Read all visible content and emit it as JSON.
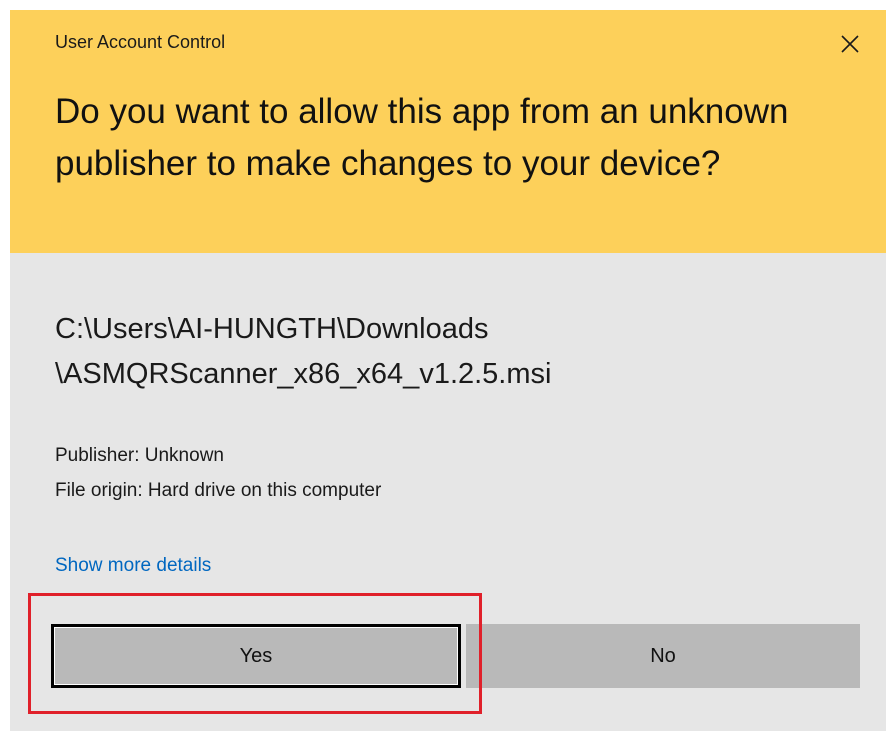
{
  "dialog": {
    "window_title": "User Account Control",
    "question": "Do you want to allow this app from an unknown publisher to make changes to your device?",
    "file_path_line1": "C:\\Users\\AI-HUNGTH\\Downloads",
    "file_path_line2": "\\ASMQRScanner_x86_x64_v1.2.5.msi",
    "publisher": "Publisher: Unknown",
    "file_origin": "File origin: Hard drive on this computer",
    "details_link": "Show more details",
    "yes_label": "Yes",
    "no_label": "No",
    "close_icon": "close-icon"
  },
  "colors": {
    "header_bg": "#fdd05a",
    "body_bg": "#e6e6e6",
    "button_bg": "#b9b9b9",
    "link": "#0067c0",
    "highlight": "#e0202a"
  }
}
